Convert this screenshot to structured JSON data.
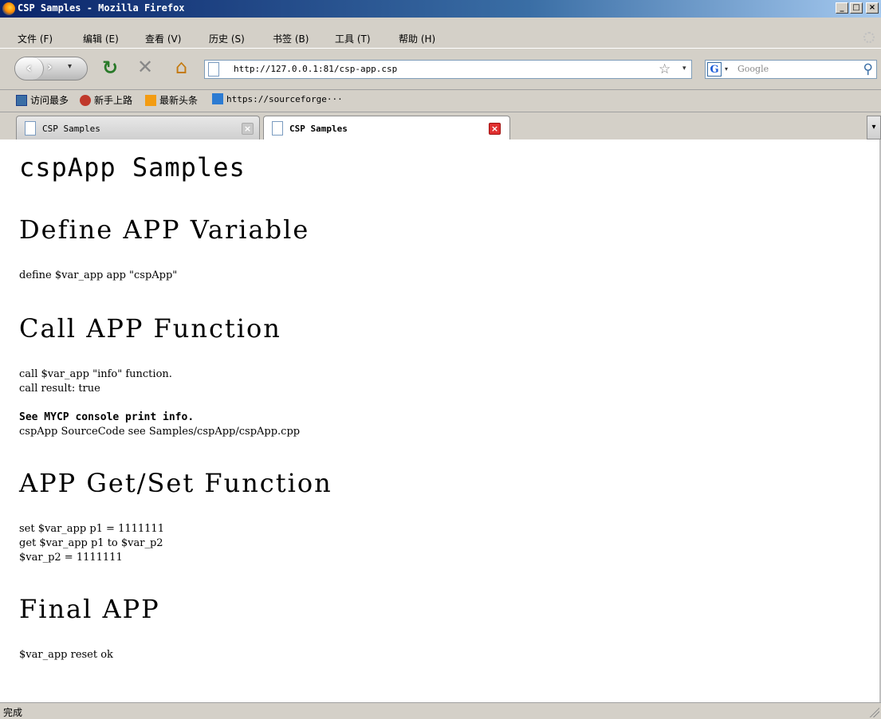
{
  "window": {
    "title": "CSP Samples - Mozilla Firefox",
    "controls": [
      "_",
      "□",
      "×"
    ]
  },
  "menu": {
    "items": [
      "文件 (F)",
      "编辑 (E)",
      "查看 (V)",
      "历史 (S)",
      "书签 (B)",
      "工具 (T)",
      "帮助 (H)"
    ]
  },
  "nav": {
    "back": "‹",
    "forward": "›",
    "dropdown": "▾",
    "reload": "↻",
    "stop": "✕",
    "home": "⌂",
    "url": "http://127.0.0.1:81/csp-app.csp",
    "star": "☆",
    "url_dropdown": "▾",
    "search_engine_icon": "G",
    "search_engine_dropdown": "▾",
    "search_placeholder": "Google",
    "search_icon": "⚲"
  },
  "bookmarks": [
    {
      "label": "访问最多",
      "icon": "most-visited-icon",
      "color": "#3a6ea5"
    },
    {
      "label": "新手上路",
      "icon": "getting-started-icon",
      "color": "#c0392b"
    },
    {
      "label": "最新头条",
      "icon": "rss-icon",
      "color": "#f39c12"
    },
    {
      "label": "https://sourceforge···",
      "icon": "sourceforge-icon",
      "color": "#2c7bd2"
    }
  ],
  "tabs": [
    {
      "label": "CSP Samples",
      "close": "×",
      "active": false
    },
    {
      "label": "CSP Samples",
      "close": "×",
      "active": true
    }
  ],
  "tab_list_arrow": "▾",
  "page": {
    "title": "cspApp Samples",
    "sections": [
      {
        "heading": "Define APP Variable",
        "lines": [
          "define $var_app app \"cspApp\""
        ]
      },
      {
        "heading": "Call APP Function",
        "lines": [
          "call $var_app \"info\" function.",
          "call result: true"
        ],
        "bold": "See MYCP console print info.",
        "after_bold": "cspApp SourceCode see Samples/cspApp/cspApp.cpp"
      },
      {
        "heading": "APP Get/Set Function",
        "lines": [
          "set $var_app p1 = 1111111",
          "get $var_app p1 to $var_p2",
          "$var_p2 = 1111111"
        ]
      },
      {
        "heading": "Final APP",
        "lines": [
          "$var_app reset ok"
        ]
      }
    ]
  },
  "status": {
    "text": "完成"
  }
}
